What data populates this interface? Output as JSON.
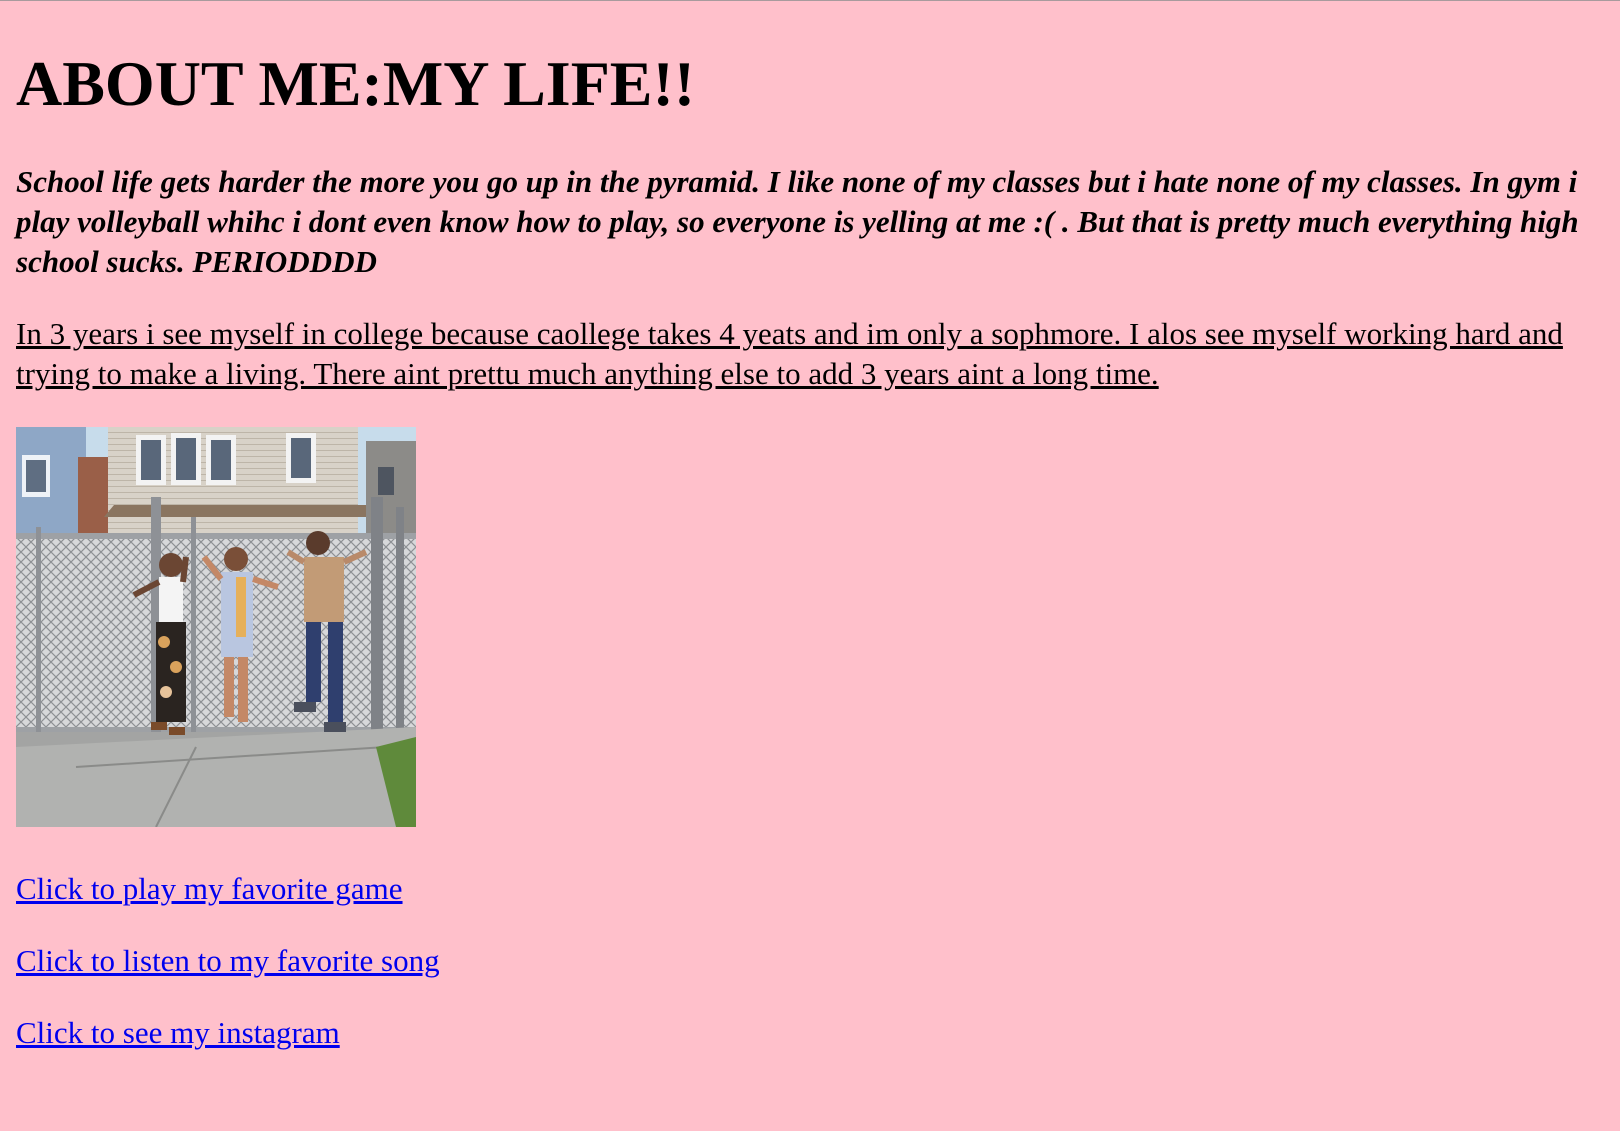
{
  "page": {
    "background_color": "#ffc0cb",
    "link_color": "#0000ee",
    "heading": "ABOUT ME:MY LIFE!!",
    "school_paragraph": "School life gets harder the more you go up in the pyramid. I like none of my classes but i hate none of my classes. In gym i play volleyball whihc i dont even know how to play, so everyone is yelling at me :( . But that is pretty much everything high school sucks. PERIODDDD",
    "future_paragraph": "In 3 years i see myself in college because caollege takes 4 yeats and im only a sophmore. I alos see myself working hard and trying to make a living. There aint prettu much anything else to add 3 years aint a long time."
  },
  "links": {
    "game": "Click to play my favorite game",
    "song": "Click to listen to my favorite song",
    "instagram": "Click to see my instagram"
  }
}
